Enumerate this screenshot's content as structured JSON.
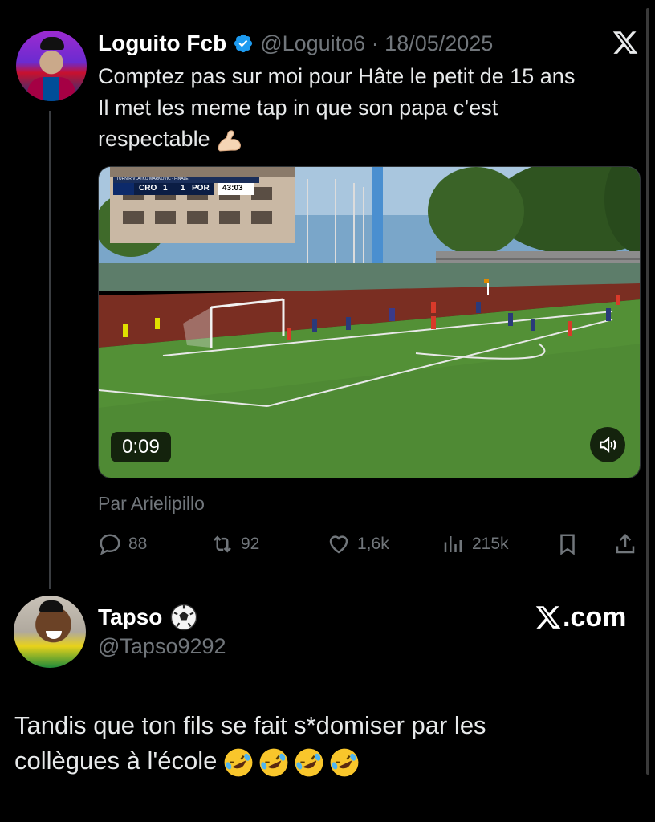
{
  "tweet1": {
    "author_name": "Loguito Fcb",
    "handle_date": "@Loguito6 · 18/05/2025",
    "text_lines": [
      "Comptez pas sur moi pour Hâte le petit de 15 ans",
      "Il met les meme tap in que son papa c’est",
      "respectable"
    ],
    "video": {
      "scorebug_title": "TURNIR VLATKO MARKOVIC - FINALE",
      "team_home": "CRO",
      "score_home": "1",
      "score_away": "1",
      "team_away": "POR",
      "match_clock": "43:03",
      "time_badge": "0:09"
    },
    "attribution": "Par Arielipillo",
    "actions": {
      "replies": "88",
      "reposts": "92",
      "likes": "1,6k",
      "views": "215k"
    }
  },
  "tweet2": {
    "author_name": "Tapso",
    "handle": "@Tapso9292",
    "brand": ".com",
    "text_lines": [
      "Tandis que ton fils se fait s*domiser par les",
      "collègues à l'école"
    ]
  },
  "icons": {
    "verified": "verified-badge-icon",
    "x_logo": "x-logo-icon",
    "soccer_ball": "soccer-ball-icon",
    "flexed_biceps": "flexed-biceps-emoji",
    "laughing": "rolling-on-floor-laughing-emoji"
  },
  "colors": {
    "background": "#000000",
    "text": "#e7e9ea",
    "muted": "#71767b",
    "verified_blue": "#1d9bf0"
  }
}
